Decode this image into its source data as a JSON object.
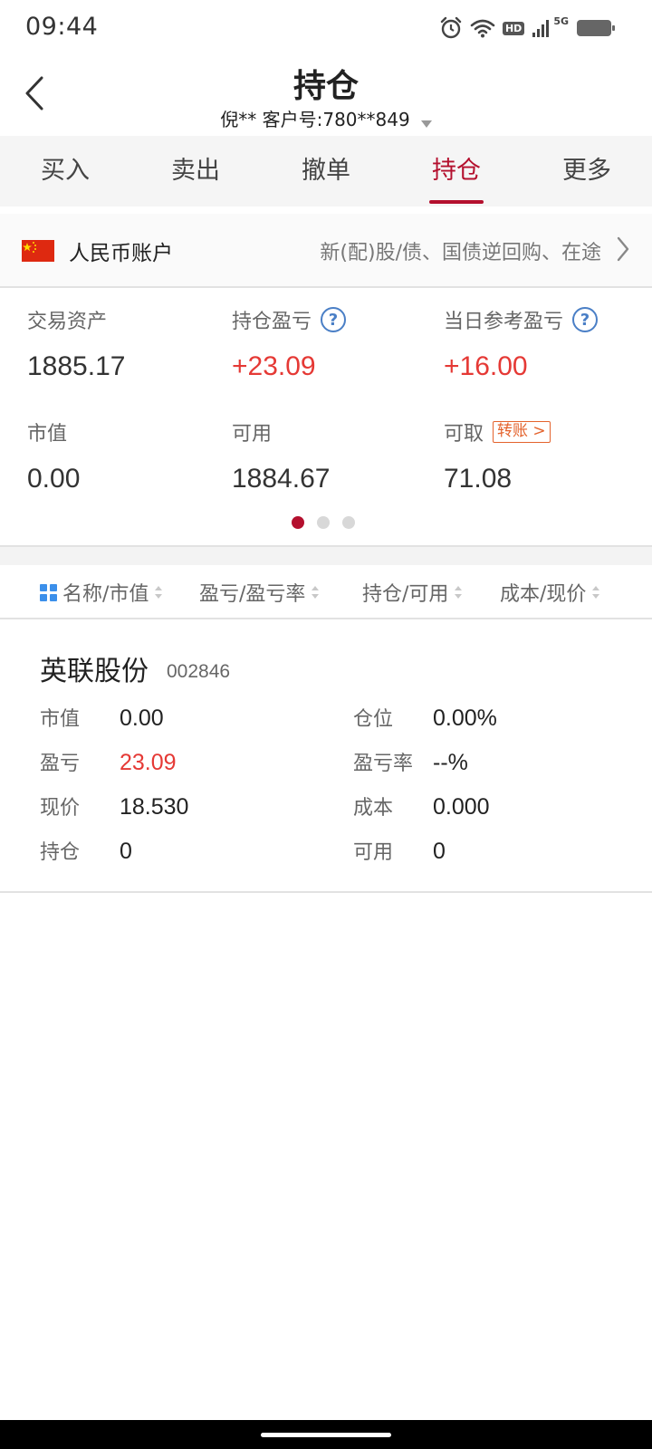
{
  "status_bar": {
    "time": "09:44",
    "icons": [
      "alarm-icon",
      "wifi-icon",
      "hd-badge",
      "signal-icon",
      "battery-icon"
    ],
    "hd_label": "HD",
    "network_label": "5G"
  },
  "header": {
    "title": "持仓",
    "account_text": "倪** 客户号:780**849",
    "back_icon": "chevron-left-icon"
  },
  "tabs": [
    {
      "label": "买入",
      "active": false
    },
    {
      "label": "卖出",
      "active": false
    },
    {
      "label": "撤单",
      "active": false
    },
    {
      "label": "持仓",
      "active": true
    },
    {
      "label": "更多",
      "active": false
    }
  ],
  "account": {
    "flag_icon": "china-flag-icon",
    "currency_label": "人民币账户",
    "description": "新(配)股/债、国债逆回购、在途"
  },
  "summary": {
    "trade_assets": {
      "label": "交易资产",
      "value": "1885.17"
    },
    "position_pnl": {
      "label": "持仓盈亏",
      "value": "+23.09"
    },
    "today_pnl": {
      "label": "当日参考盈亏",
      "value": "+16.00"
    },
    "market_value": {
      "label": "市值",
      "value": "0.00"
    },
    "available": {
      "label": "可用",
      "value": "1884.67"
    },
    "withdrawable": {
      "label": "可取",
      "value": "71.08",
      "transfer_label": "转账 >"
    },
    "pager": {
      "pages": 3,
      "current": 1
    }
  },
  "columns": {
    "name": "名称/市值",
    "pnl": "盈亏/盈亏率",
    "position": "持仓/可用",
    "cost": "成本/现价"
  },
  "stock": {
    "name": "英联股份",
    "code": "002846",
    "fields": {
      "market_value": {
        "label": "市值",
        "value": "0.00"
      },
      "position_ratio": {
        "label": "仓位",
        "value": "0.00%"
      },
      "pnl": {
        "label": "盈亏",
        "value": "23.09"
      },
      "pnl_rate": {
        "label": "盈亏率",
        "value": "--%"
      },
      "current_price": {
        "label": "现价",
        "value": "18.530"
      },
      "cost": {
        "label": "成本",
        "value": "0.000"
      },
      "holding": {
        "label": "持仓",
        "value": "0"
      },
      "available": {
        "label": "可用",
        "value": "0"
      }
    }
  },
  "colors": {
    "accent": "#b4102e",
    "profit": "#e53935",
    "help": "#4a7fc6",
    "transfer": "#e4632d",
    "grid_icon": "#3b8fea"
  }
}
